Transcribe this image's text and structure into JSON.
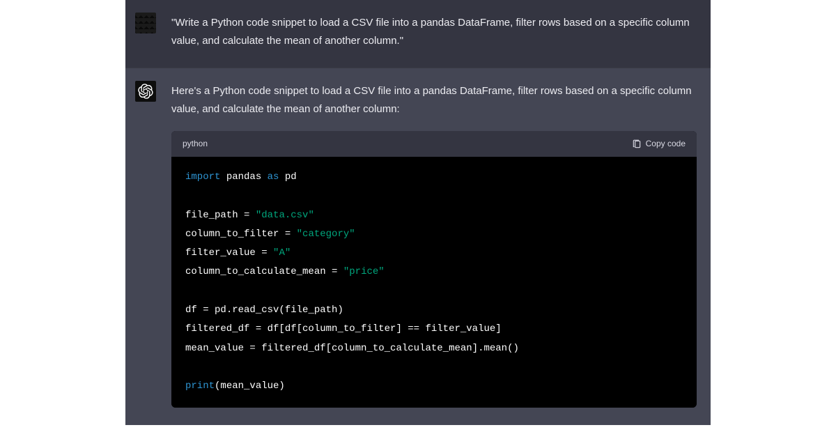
{
  "user": {
    "message": "\"Write a Python code snippet to load a CSV file into a pandas DataFrame, filter rows based on a specific column value, and calculate the mean of another column.\""
  },
  "assistant": {
    "intro": "Here's a Python code snippet to load a CSV file into a pandas DataFrame, filter rows based on a specific column value, and calculate the mean of another column:",
    "code": {
      "language": "python",
      "copy_label": "Copy code",
      "tokens": {
        "import": "import",
        "pandas": "pandas",
        "as": "as",
        "pd": "pd",
        "file_path": "file_path",
        "eq": " = ",
        "data_csv": "\"data.csv\"",
        "column_to_filter": "column_to_filter",
        "category": "\"category\"",
        "filter_value": "filter_value",
        "a": "\"A\"",
        "column_to_calculate_mean": "column_to_calculate_mean",
        "price": "\"price\"",
        "df": "df",
        "read_csv": " = pd.read_csv(file_path)",
        "filtered_df": "filtered_df",
        "filter_expr": " = df[df[column_to_filter] == filter_value]",
        "mean_value": "mean_value",
        "mean_expr": " = filtered_df[column_to_calculate_mean].mean()",
        "print": "print",
        "print_arg": "(mean_value)"
      }
    }
  }
}
